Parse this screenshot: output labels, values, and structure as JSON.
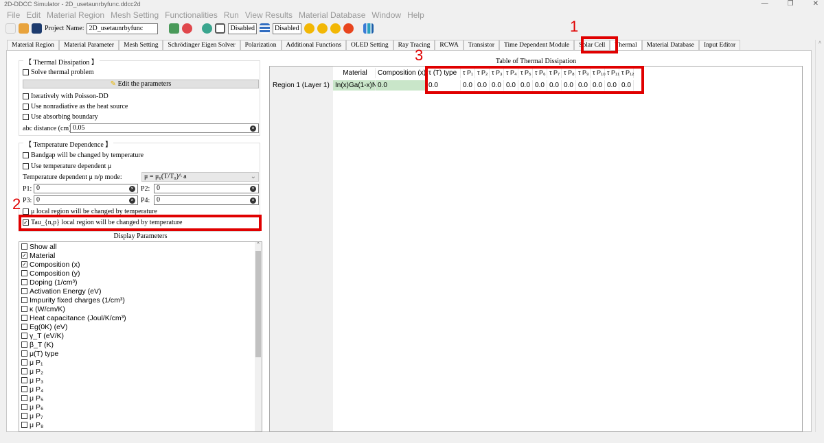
{
  "window": {
    "title": "2D-DDCC Simulator - 2D_usetaunrbyfunc.ddcc2d",
    "controls": [
      "—",
      "❐",
      "✕"
    ]
  },
  "menu": [
    "File",
    "Edit",
    "Material Region",
    "Mesh Setting",
    "Functionalities",
    "Run",
    "View Results",
    "Material Database",
    "Window",
    "Help"
  ],
  "toolbar": {
    "project_label": "Project Name:",
    "project_name": "2D_usetaunrbyfunc",
    "disabled1": "Disabled",
    "disabled2": "Disabled"
  },
  "tabs": [
    "Material Region",
    "Material Parameter",
    "Mesh Setting",
    "Schrödinger Eigen Solver",
    "Polarization",
    "Additional Functions",
    "OLED Setting",
    "Ray Tracing",
    "RCWA",
    "Transistor",
    "Time Dependent Module",
    "Solar Cell",
    "Thermal",
    "Material Database",
    "Input Editor"
  ],
  "active_tab": "Thermal",
  "thermal": {
    "title": "【 Thermal Dissipation 】",
    "solve": "Solve thermal problem",
    "edit_button": "Edit the parameters",
    "iterative": "Iteratively with Poisson-DD",
    "nonradiative": "Use nonradiative as the heat source",
    "absorbing": "Use absorbing boundary",
    "abc_label": "abc distance (cm):",
    "abc_value": "0.05"
  },
  "temp": {
    "title": "【 Temperature Dependence 】",
    "bandgap": "Bandgap will be changed by temperature",
    "use_mu": "Use temperature dependent  μ",
    "mode_label": "Temperature dependent  μ n/p mode:",
    "mode_value": "μ  =  μ₀(T/T₀)^ a",
    "p1_label": "P1:",
    "p1": "0",
    "p2_label": "P2:",
    "p2": "0",
    "p3_label": "P3:",
    "p3": "0",
    "p4_label": "P4:",
    "p4": "0",
    "mu_local": "μ  local region will be changed by temperature",
    "tau_local": "Tau_{n,p} local region will be changed by temperature"
  },
  "display": {
    "title": "Display Parameters",
    "items": [
      {
        "label": "Show all",
        "checked": false
      },
      {
        "label": "Material",
        "checked": true
      },
      {
        "label": "Composition (x)",
        "checked": true
      },
      {
        "label": "Composition (y)",
        "checked": false
      },
      {
        "label": "Doping (1/cm³)",
        "checked": false
      },
      {
        "label": "Activation Energy (eV)",
        "checked": false
      },
      {
        "label": "Impurity fixed charges (1/cm³)",
        "checked": false
      },
      {
        "label": "κ (W/cm/K)",
        "checked": false
      },
      {
        "label": "Heat capacitance (Joul/K/cm³)",
        "checked": false
      },
      {
        "label": "Eg(0K) (eV)",
        "checked": false
      },
      {
        "label": "γ_T (eV/K)",
        "checked": false
      },
      {
        "label": "β_T (K)",
        "checked": false
      },
      {
        "label": "μ(T) type",
        "checked": false
      },
      {
        "label": "μ P₁",
        "checked": false
      },
      {
        "label": "μ P₂",
        "checked": false
      },
      {
        "label": "μ P₃",
        "checked": false
      },
      {
        "label": "μ P₄",
        "checked": false
      },
      {
        "label": "μ P₅",
        "checked": false
      },
      {
        "label": "μ P₆",
        "checked": false
      },
      {
        "label": "μ P₇",
        "checked": false
      },
      {
        "label": "μ P₈",
        "checked": false
      }
    ]
  },
  "table": {
    "title": "Table of Thermal Dissipation",
    "columns": [
      "Material",
      "Composition (x)",
      "τ (T) type",
      "τ P₁",
      "τ P₂",
      "τ P₃",
      "τ P₄",
      "τ P₅",
      "τ P₆",
      "τ P₇",
      "τ P₈",
      "τ P₉",
      "τ P₁₀",
      "τ P₁₁",
      "τ P₁₂"
    ],
    "rows": [
      {
        "header": "Region 1 (Layer 1)",
        "cells": [
          "In(x)Ga(1-x)N",
          "0.0",
          "0.0",
          "0.0",
          "0.0",
          "0.0",
          "0.0",
          "0.0",
          "0.0",
          "0.0",
          "0.0",
          "0.0",
          "0.0",
          "0.0",
          "0.0"
        ]
      }
    ]
  },
  "annotations": [
    "1",
    "2",
    "3"
  ],
  "colors": {
    "annotation": "#e00000",
    "material_cell": "#c9e6c9"
  }
}
